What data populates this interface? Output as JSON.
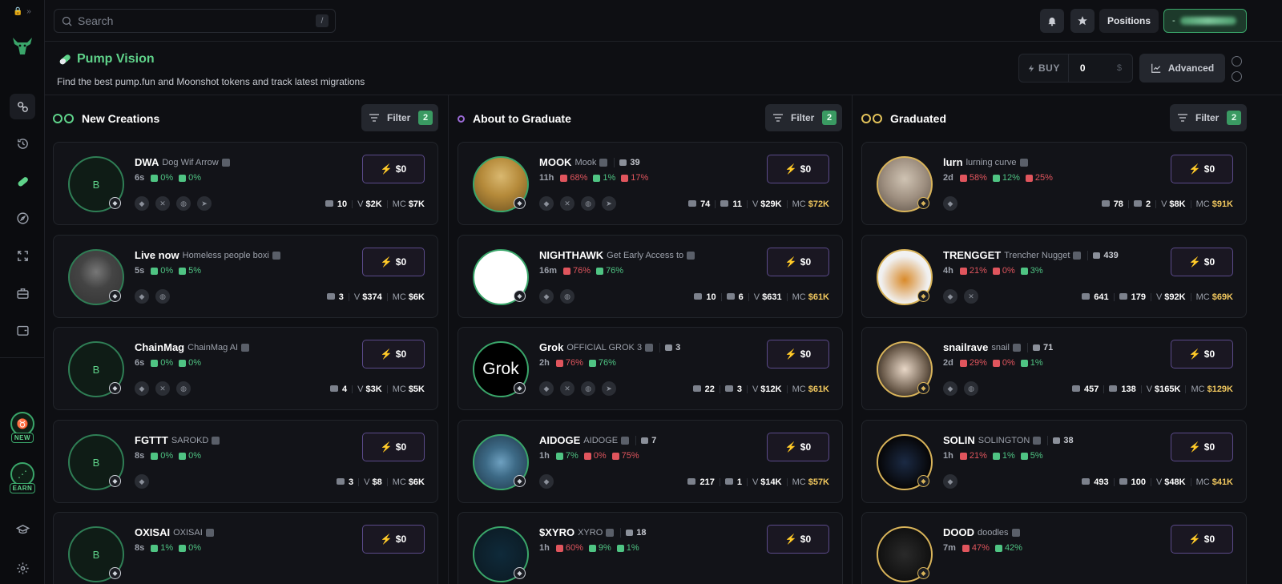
{
  "sidebar": {
    "top_icons": [
      "lock-icon",
      "double-chevron-icon"
    ],
    "items": [
      "link-icon",
      "history-icon",
      "pill-icon",
      "compass-icon",
      "refresh-icon",
      "briefcase-icon",
      "wallet-icon"
    ],
    "new_badge": "NEW",
    "earn_badge": "EARN",
    "bottom_items": [
      "graduation-cap-icon",
      "gear-icon"
    ]
  },
  "topbar": {
    "search_placeholder": "Search",
    "search_shortcut": "/",
    "positions_label": "Positions"
  },
  "header": {
    "title": "Pump Vision",
    "subtitle": "Find the best pump.fun and Moonshot tokens and track latest migrations",
    "buy_label": "BUY",
    "buy_amount": "0",
    "currency": "$",
    "advanced_label": "Advanced"
  },
  "colors": {
    "accent_green": "#5fd38a",
    "danger_red": "#e0555d",
    "gold": "#f0c75e",
    "quick_buy_border": "#5b4a8a"
  },
  "columns": [
    {
      "title": "New Creations",
      "filter_label": "Filter",
      "filter_count": "2",
      "cards": [
        {
          "symbol": "DWA",
          "name": "Dog Wif Arrow",
          "age": "6s",
          "stats": [
            {
              "v": "0%",
              "t": "g"
            },
            {
              "v": "0%",
              "t": "g"
            }
          ],
          "socials": [
            "pill",
            "x",
            "globe",
            "telegram"
          ],
          "buy": "$0",
          "holders": "10",
          "volume": "$2K",
          "mc": "$7K",
          "avatar_letter": "B"
        },
        {
          "symbol": "Live now",
          "name": "Homeless people boxi",
          "age": "5s",
          "stats": [
            {
              "v": "0%",
              "t": "g"
            },
            {
              "v": "5%",
              "t": "g"
            }
          ],
          "socials": [
            "pill",
            "globe"
          ],
          "buy": "$0",
          "holders": "3",
          "volume": "$374",
          "mc": "$6K",
          "avatar_letter": ""
        },
        {
          "symbol": "ChainMag",
          "name": "ChainMag AI",
          "age": "6s",
          "stats": [
            {
              "v": "0%",
              "t": "g"
            },
            {
              "v": "0%",
              "t": "g"
            }
          ],
          "socials": [
            "pill",
            "x",
            "globe"
          ],
          "buy": "$0",
          "holders": "4",
          "volume": "$3K",
          "mc": "$5K",
          "avatar_letter": "B"
        },
        {
          "symbol": "FGTTT",
          "name": "SAROKD",
          "age": "8s",
          "stats": [
            {
              "v": "0%",
              "t": "g"
            },
            {
              "v": "0%",
              "t": "g"
            }
          ],
          "socials": [
            "pill"
          ],
          "buy": "$0",
          "holders": "3",
          "volume": "$8",
          "mc": "$6K",
          "avatar_letter": "B"
        },
        {
          "symbol": "OXISAI",
          "name": "OXISAI",
          "age": "8s",
          "stats": [
            {
              "v": "1%",
              "t": "g"
            },
            {
              "v": "0%",
              "t": "g"
            }
          ],
          "socials": [],
          "buy": "$0",
          "holders": "",
          "volume": "",
          "mc": "",
          "avatar_letter": "B"
        }
      ]
    },
    {
      "title": "About to Graduate",
      "filter_label": "Filter",
      "filter_count": "2",
      "cards": [
        {
          "symbol": "MOOK",
          "name": "Mook",
          "replies": "39",
          "age": "11h",
          "stats": [
            {
              "v": "68%",
              "t": "r"
            },
            {
              "v": "1%",
              "t": "g"
            },
            {
              "v": "17%",
              "t": "r"
            }
          ],
          "socials": [
            "pill",
            "x",
            "globe",
            "telegram"
          ],
          "buy": "$0",
          "holders": "74",
          "txns": "11",
          "volume": "$29K",
          "mc": "$72K"
        },
        {
          "symbol": "NIGHTHAWK",
          "name": "Get Early Access to",
          "age": "16m",
          "stats": [
            {
              "v": "76%",
              "t": "r"
            },
            {
              "v": "76%",
              "t": "g"
            }
          ],
          "socials": [
            "pill",
            "globe"
          ],
          "buy": "$0",
          "holders": "10",
          "txns": "6",
          "volume": "$631",
          "mc": "$61K"
        },
        {
          "symbol": "Grok",
          "name": "OFFICIAL GROK 3",
          "replies": "3",
          "age": "2h",
          "stats": [
            {
              "v": "76%",
              "t": "r"
            },
            {
              "v": "76%",
              "t": "g"
            }
          ],
          "socials": [
            "pill",
            "x",
            "globe",
            "telegram"
          ],
          "buy": "$0",
          "holders": "22",
          "txns": "3",
          "volume": "$12K",
          "mc": "$61K",
          "avatar_text": "Grok"
        },
        {
          "symbol": "AIDOGE",
          "name": "AIDOGE",
          "replies": "7",
          "age": "1h",
          "stats": [
            {
              "v": "7%",
              "t": "g"
            },
            {
              "v": "0%",
              "t": "r"
            },
            {
              "v": "75%",
              "t": "r"
            }
          ],
          "socials": [
            "pill"
          ],
          "buy": "$0",
          "holders": "217",
          "txns": "1",
          "volume": "$14K",
          "mc": "$57K"
        },
        {
          "symbol": "$XYRO",
          "name": "XYRO",
          "replies": "18",
          "age": "1h",
          "stats": [
            {
              "v": "60%",
              "t": "r"
            },
            {
              "v": "9%",
              "t": "g"
            },
            {
              "v": "1%",
              "t": "g"
            }
          ],
          "socials": [],
          "buy": "$0",
          "holders": "",
          "txns": "",
          "volume": "",
          "mc": ""
        }
      ]
    },
    {
      "title": "Graduated",
      "filter_label": "Filter",
      "filter_count": "2",
      "cards": [
        {
          "symbol": "lurn",
          "name": "lurning curve",
          "age": "2d",
          "stats": [
            {
              "v": "58%",
              "t": "r"
            },
            {
              "v": "12%",
              "t": "g"
            },
            {
              "v": "25%",
              "t": "r"
            }
          ],
          "socials": [
            "pill"
          ],
          "buy": "$0",
          "holders": "78",
          "txns": "2",
          "volume": "$8K",
          "mc": "$91K"
        },
        {
          "symbol": "TRENGGET",
          "name": "Trencher Nugget",
          "replies": "439",
          "age": "4h",
          "stats": [
            {
              "v": "21%",
              "t": "r"
            },
            {
              "v": "0%",
              "t": "r"
            },
            {
              "v": "3%",
              "t": "g"
            }
          ],
          "socials": [
            "pill",
            "x"
          ],
          "buy": "$0",
          "holders": "641",
          "txns": "179",
          "volume": "$92K",
          "mc": "$69K"
        },
        {
          "symbol": "snailrave",
          "name": "snail",
          "replies": "71",
          "age": "2d",
          "stats": [
            {
              "v": "29%",
              "t": "r"
            },
            {
              "v": "0%",
              "t": "r"
            },
            {
              "v": "1%",
              "t": "g"
            }
          ],
          "socials": [
            "pill",
            "globe"
          ],
          "buy": "$0",
          "holders": "457",
          "txns": "138",
          "volume": "$165K",
          "mc": "$129K"
        },
        {
          "symbol": "SOLIN",
          "name": "SOLINGTON",
          "replies": "38",
          "age": "1h",
          "stats": [
            {
              "v": "21%",
              "t": "r"
            },
            {
              "v": "1%",
              "t": "g"
            },
            {
              "v": "5%",
              "t": "g"
            }
          ],
          "socials": [
            "pill"
          ],
          "buy": "$0",
          "holders": "493",
          "txns": "100",
          "volume": "$48K",
          "mc": "$41K"
        },
        {
          "symbol": "DOOD",
          "name": "doodles",
          "age": "7m",
          "stats": [
            {
              "v": "47%",
              "t": "r"
            },
            {
              "v": "42%",
              "t": "g"
            }
          ],
          "socials": [],
          "buy": "$0",
          "holders": "",
          "txns": "",
          "volume": "",
          "mc": ""
        }
      ]
    }
  ],
  "metric_labels": {
    "volume": "V",
    "mc": "MC"
  }
}
